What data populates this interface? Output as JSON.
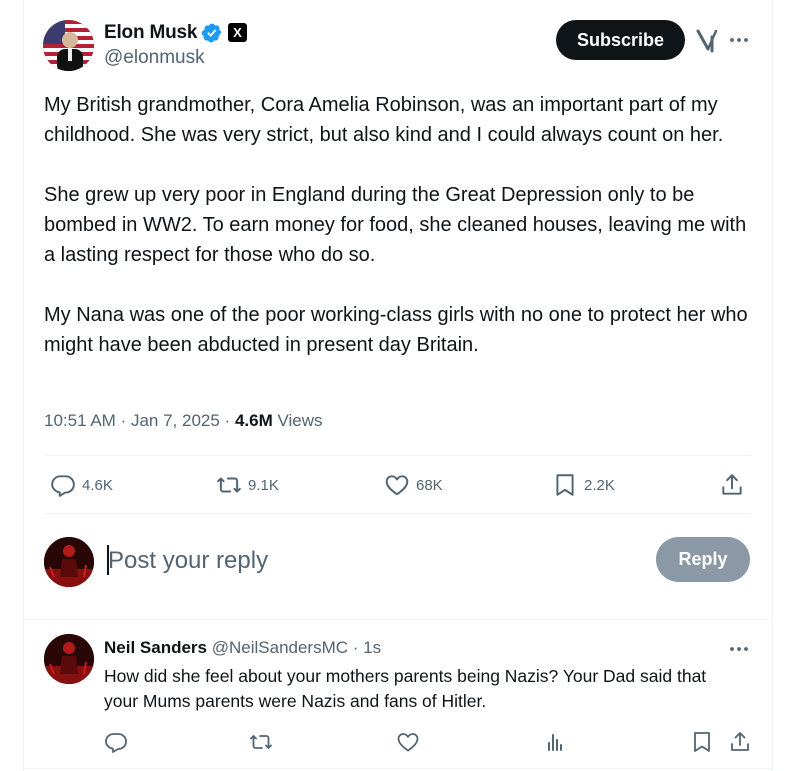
{
  "post": {
    "author_name": "Elon Musk",
    "author_handle": "@elonmusk",
    "x_badge_letter": "X",
    "subscribe_label": "Subscribe",
    "paragraphs": [
      "My British grandmother, Cora Amelia Robinson, was an important part of my childhood. She was very strict, but also kind and I could always count on her.",
      "She grew up very poor in England during the Great Depression only to be bombed in WW2. To earn money for food, she cleaned houses, leaving me with a lasting respect for those who do so.",
      "My Nana was one of the poor working-class girls with no one to protect her who might have been abducted in present day Britain."
    ],
    "time": "10:51 AM",
    "date": "Jan 7, 2025",
    "views_count": "4.6M",
    "views_label": "Views",
    "stats": {
      "replies": "4.6K",
      "reposts": "9.1K",
      "likes": "68K",
      "bookmarks": "2.2K"
    }
  },
  "composer": {
    "placeholder": "Post your reply",
    "reply_label": "Reply"
  },
  "reply": {
    "author_name": "Neil Sanders",
    "author_handle": "@NeilSandersMC",
    "time": "1s",
    "text": "How did she feel about your mothers parents being Nazis? Your Dad said that your Mums parents were Nazis and fans of Hitler."
  },
  "icons": {
    "verified": "verified-badge-icon",
    "x_logo": "x-logo-icon",
    "grok": "grok-icon",
    "more": "more-icon",
    "reply": "reply-icon",
    "repost": "repost-icon",
    "like": "like-icon",
    "bookmark": "bookmark-icon",
    "share": "share-icon",
    "analytics": "analytics-icon"
  },
  "colors": {
    "text_primary": "#0f1419",
    "text_secondary": "#536471",
    "verified_blue": "#1d9bf0",
    "reply_button_disabled": "#8b98a5",
    "border": "#eff3f4"
  }
}
